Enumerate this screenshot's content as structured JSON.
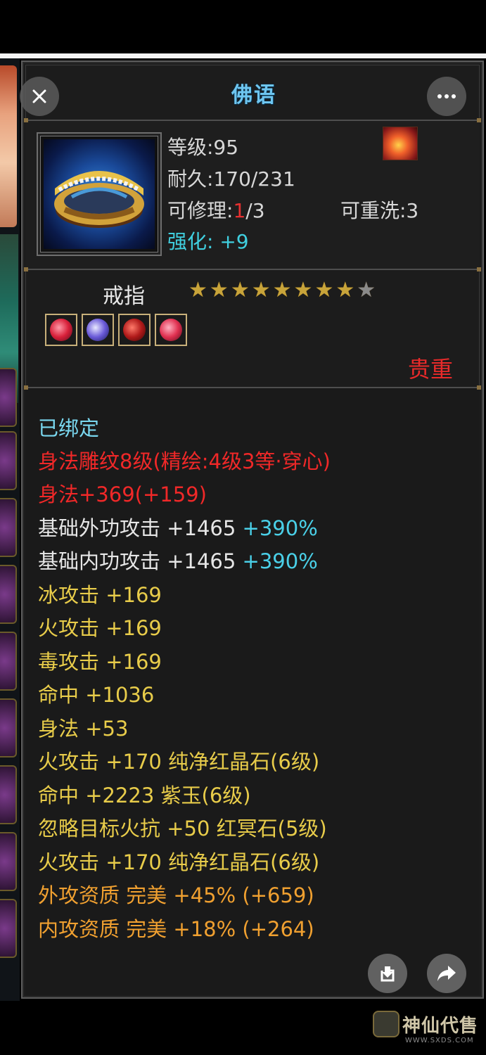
{
  "item": {
    "name": "佛语",
    "level": "等级:95",
    "durability": "耐久:170/231",
    "repair_prefix": "可修理:",
    "repair_current": "1",
    "repair_suffix": "/3",
    "rewash": "可重洗:3",
    "enhance_label": "强化:",
    "enhance_value": "+9",
    "type": "戒指",
    "stars_filled": 8,
    "stars_total": 9,
    "rarity": "贵重"
  },
  "attributes": {
    "bound": "已绑定",
    "engrave": "身法雕纹8级(精绘:4级3等·穿心)",
    "agility_engrave": "身法+369(+159)",
    "ext_attack_label": "基础外功攻击 +1465",
    "ext_attack_pct": "+390%",
    "int_attack_label": "基础内功攻击 +1465",
    "int_attack_pct": "+390%",
    "ice": "冰攻击 +169",
    "fire": "火攻击 +169",
    "poison": "毒攻击 +169",
    "hit": "命中 +1036",
    "agility": "身法 +53",
    "gem1": "火攻击 +170 纯净红晶石(6级)",
    "gem2": "命中 +2223 紫玉(6级)",
    "gem3": "忽略目标火抗 +50 红冥石(5级)",
    "gem4": "火攻击 +170 纯净红晶石(6级)",
    "ext_quality": "外攻资质  完美 +45% (+659)",
    "int_quality": "内攻资质  完美 +18% (+264)"
  },
  "colors": {
    "title": "#6ec6f0",
    "rarity": "#e82a2a",
    "engrave": "#f02828",
    "percent": "#4ad0e8",
    "yellow_stat": "#e8cc4a",
    "orange_stat": "#f0a030"
  },
  "icons": {
    "close": "close-icon",
    "more": "more-icon",
    "download": "download-icon",
    "share": "share-icon"
  },
  "watermark": {
    "text": "神仙代售",
    "url": "WWW.SXDS.COM"
  }
}
